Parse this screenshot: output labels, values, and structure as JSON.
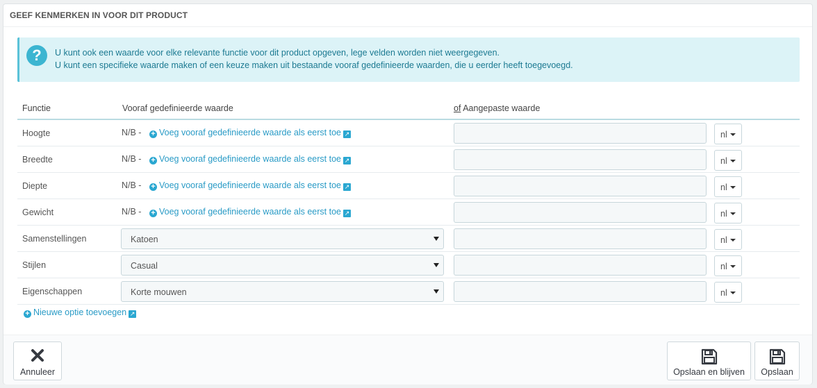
{
  "panel": {
    "title": "GEEF KENMERKEN IN VOOR DIT PRODUCT"
  },
  "alert": {
    "icon": "question-circle-icon",
    "line1": "U kunt ook een waarde voor elke relevante functie voor dit product opgeven, lege velden worden niet weergegeven.",
    "line2": "U kunt een specifieke waarde maken of een keuze maken uit bestaande vooraf gedefinieerde waarden, die u eerder heeft toegevoegd."
  },
  "table": {
    "headers": {
      "function": "Functie",
      "predefined": "Vooraf gedefinieerde waarde",
      "custom_prefix": "of",
      "custom": " Aangepaste waarde"
    },
    "rows": [
      {
        "name": "Hoogte",
        "na": "N/B -",
        "add_link": "Voeg vooraf gedefinieerde waarde als eerst toe",
        "custom_value": "",
        "lang": "nl"
      },
      {
        "name": "Breedte",
        "na": "N/B -",
        "add_link": "Voeg vooraf gedefinieerde waarde als eerst toe",
        "custom_value": "",
        "lang": "nl"
      },
      {
        "name": "Diepte",
        "na": "N/B -",
        "add_link": "Voeg vooraf gedefinieerde waarde als eerst toe",
        "custom_value": "",
        "lang": "nl"
      },
      {
        "name": "Gewicht",
        "na": "N/B -",
        "add_link": "Voeg vooraf gedefinieerde waarde als eerst toe",
        "custom_value": "",
        "lang": "nl"
      },
      {
        "name": "Samenstellingen",
        "selected": "Katoen",
        "custom_value": "",
        "lang": "nl"
      },
      {
        "name": "Stijlen",
        "selected": "Casual",
        "custom_value": "",
        "lang": "nl"
      },
      {
        "name": "Eigenschappen",
        "selected": "Korte mouwen",
        "custom_value": "",
        "lang": "nl"
      }
    ]
  },
  "new_option_link": "Nieuwe optie toevoegen",
  "footer": {
    "cancel_label": "Annuleer",
    "save_stay_label": "Opslaan en blijven",
    "save_label": "Opslaan"
  },
  "colors": {
    "accent": "#2a9bc6",
    "alert_bg": "#dcf3f7",
    "alert_text": "#1c7a92"
  }
}
